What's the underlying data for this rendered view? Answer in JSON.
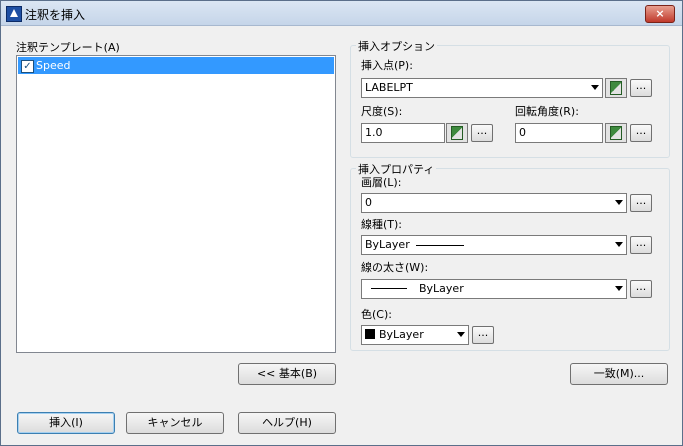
{
  "window": {
    "title": "注釈を挿入",
    "close": "×"
  },
  "template_list": {
    "label": "注釈テンプレート(A)",
    "items": [
      {
        "label": "Speed",
        "checked": true,
        "selected": true
      }
    ]
  },
  "insert_options": {
    "group_title": "挿入オプション",
    "insertion_point": {
      "label": "挿入点(P):",
      "value": "LABELPT"
    },
    "scale": {
      "label": "尺度(S):",
      "value": "1.0"
    },
    "rotation": {
      "label": "回転角度(R):",
      "value": "0"
    }
  },
  "insert_properties": {
    "group_title": "挿入プロパティ",
    "layer": {
      "label": "画層(L):",
      "value": "0"
    },
    "linetype": {
      "label": "線種(T):",
      "value": "ByLayer"
    },
    "lineweight": {
      "label": "線の太さ(W):",
      "value": "ByLayer"
    },
    "color": {
      "label": "色(C):",
      "value": "ByLayer"
    }
  },
  "buttons": {
    "basic": "<< 基本(B)",
    "match": "一致(M)...",
    "insert": "挿入(I)",
    "cancel": "キャンセル",
    "help": "ヘルプ(H)",
    "ellipsis": "..."
  },
  "colors": {
    "selection": "#3399ff",
    "title_bar": "#c5d5e9"
  }
}
